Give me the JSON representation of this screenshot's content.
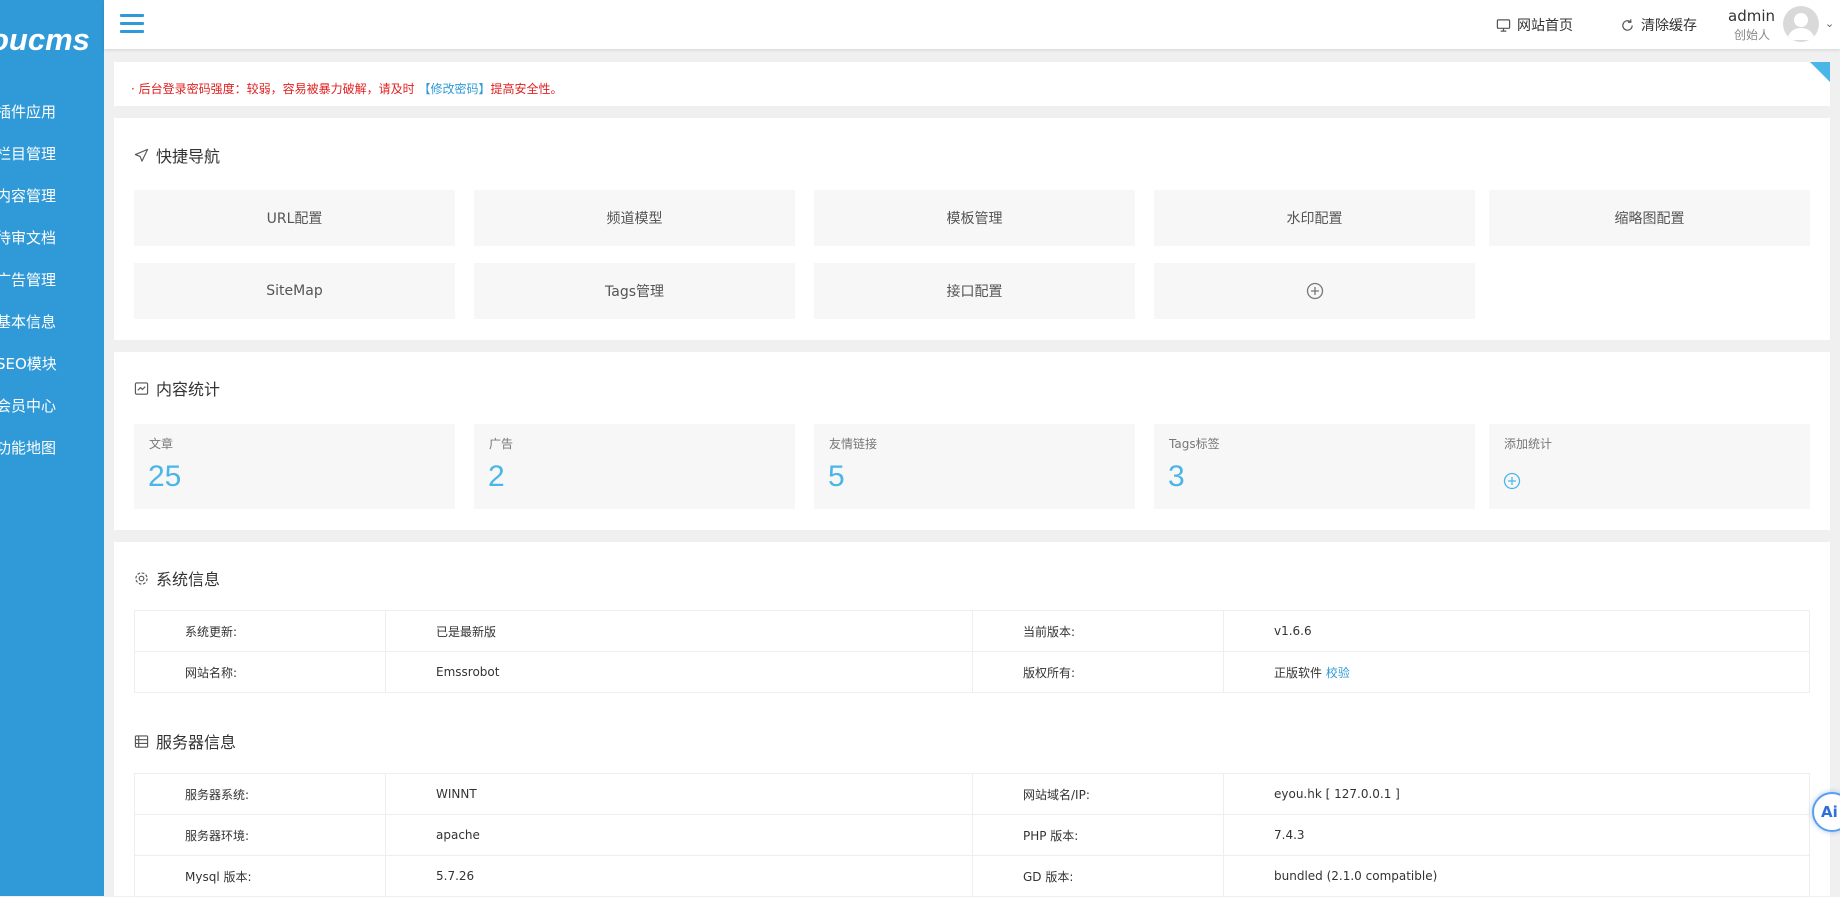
{
  "sidebar": {
    "logo": "oucms",
    "items": [
      {
        "label": "插件应用"
      },
      {
        "label": "栏目管理"
      },
      {
        "label": "内容管理"
      },
      {
        "label": "待审文档"
      },
      {
        "label": "广告管理"
      },
      {
        "label": "基本信息"
      },
      {
        "label": "SEO模块"
      },
      {
        "label": "会员中心"
      },
      {
        "label": "功能地图"
      }
    ]
  },
  "topbar": {
    "home_label": "网站首页",
    "clear_cache_label": "清除缓存",
    "user_name": "admin",
    "user_role": "创始人"
  },
  "alert": {
    "prefix": "· 后台登录密码强度：较弱，容易被暴力破解，请及时",
    "link": "【修改密码】",
    "suffix": "提高安全性。"
  },
  "quick_nav": {
    "title": "快捷导航",
    "tiles": [
      {
        "label": "URL配置"
      },
      {
        "label": "频道模型"
      },
      {
        "label": "模板管理"
      },
      {
        "label": "水印配置"
      },
      {
        "label": "缩略图配置"
      },
      {
        "label": "SiteMap"
      },
      {
        "label": "Tags管理"
      },
      {
        "label": "接口配置"
      }
    ],
    "add_icon": "plus-circle-icon"
  },
  "stats": {
    "title": "内容统计",
    "items": [
      {
        "label": "文章",
        "value": "25"
      },
      {
        "label": "广告",
        "value": "2"
      },
      {
        "label": "友情链接",
        "value": "5"
      },
      {
        "label": "Tags标签",
        "value": "3"
      }
    ],
    "add_label": "添加统计"
  },
  "system_info": {
    "title": "系统信息",
    "rows": [
      {
        "k1": "系统更新:",
        "v1": "已是最新版",
        "k2": "当前版本:",
        "v2": "v1.6.6"
      },
      {
        "k1": "网站名称:",
        "v1": "Emssrobot",
        "k2": "版权所有:",
        "v2": "正版软件",
        "v2_link": "校验"
      }
    ]
  },
  "server_info": {
    "title": "服务器信息",
    "rows": [
      {
        "k1": "服务器系统:",
        "v1": "WINNT",
        "k2": "网站域名/IP:",
        "v2": "eyou.hk [ 127.0.0.1 ]"
      },
      {
        "k1": "服务器环境:",
        "v1": "apache",
        "k2": "PHP 版本:",
        "v2": "7.4.3"
      },
      {
        "k1": "Mysql 版本:",
        "v1": "5.7.26",
        "k2": "GD 版本:",
        "v2": "bundled (2.1.0 compatible)"
      }
    ]
  },
  "ai_badge": "Ai",
  "colors": {
    "accent": "#2f9ad7",
    "stat_number": "#4ab6e8",
    "alert": "#e02020"
  }
}
